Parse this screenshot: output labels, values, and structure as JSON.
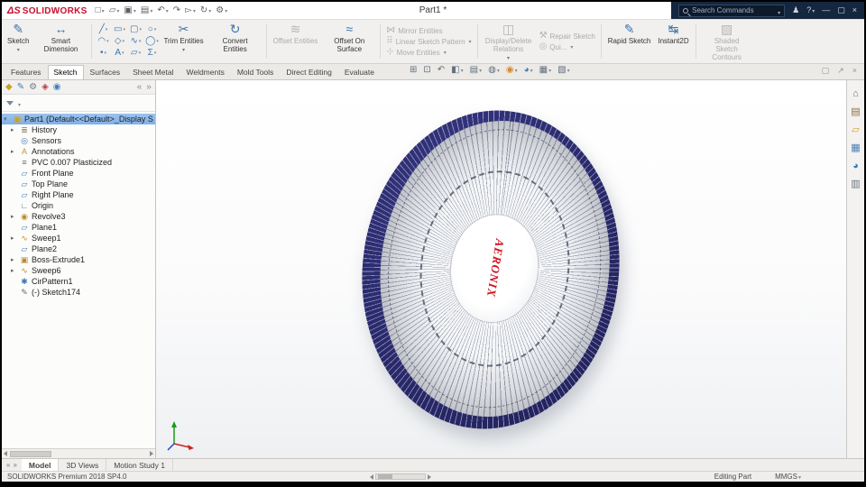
{
  "titlebar": {
    "brand_mark": "ΔS",
    "brand": "SOLIDWORKS",
    "doc_title": "Part1 *",
    "search_placeholder": "Search Commands",
    "qat_icons": [
      {
        "name": "new-file-icon",
        "glyph": "□",
        "caret": true
      },
      {
        "name": "open-file-icon",
        "glyph": "▱",
        "caret": true
      },
      {
        "name": "save-icon",
        "glyph": "▣",
        "caret": true
      },
      {
        "name": "print-icon",
        "glyph": "▤",
        "caret": true
      },
      {
        "name": "undo-icon",
        "glyph": "↶",
        "caret": true
      },
      {
        "name": "redo-icon",
        "glyph": "↷"
      },
      {
        "name": "select-icon",
        "glyph": "▻",
        "caret": true
      },
      {
        "name": "rebuild-icon",
        "glyph": "↻",
        "caret": true
      },
      {
        "name": "options-icon",
        "glyph": "⚙",
        "caret": true
      }
    ],
    "window_icons": [
      {
        "name": "user-icon",
        "glyph": "♟"
      },
      {
        "name": "help-icon",
        "glyph": "?",
        "caret": true
      },
      {
        "name": "minimize-icon",
        "glyph": "—"
      },
      {
        "name": "maximize-icon",
        "glyph": "▢"
      },
      {
        "name": "close-icon",
        "glyph": "×"
      }
    ]
  },
  "icons": {
    "sketch": "✎",
    "smart_dimension": "↔",
    "trim": "✂",
    "convert": "↻",
    "offset": "≋",
    "offset_surface": "≈",
    "mirror": "⋈",
    "linear_pattern": "⠿",
    "move": "⊹",
    "display_delete": "◫",
    "repair": "⚒",
    "quick_snaps": "◎",
    "rapid": "✎",
    "instant2d": "↹",
    "shaded_contours": "▨",
    "part_root": "▣"
  },
  "ribbon": {
    "sketch": "Sketch",
    "smart_dimension": "Smart Dimension",
    "trim": "Trim Entities",
    "convert": "Convert Entities",
    "offset": "Offset Entities",
    "offset_surface": "Offset On Surface",
    "mirror": "Mirror Entities",
    "linear_pattern": "Linear Sketch Pattern",
    "move": "Move Entities",
    "display_delete": "Display/Delete Relations",
    "repair": "Repair Sketch",
    "quick_snaps": "Qui...",
    "rapid": "Rapid Sketch",
    "instant2d": "Instant2D",
    "shaded_contours": "Shaded Sketch Contours",
    "entity_icons": [
      {
        "name": "line-icon",
        "glyph": "╱"
      },
      {
        "name": "rectangle-icon",
        "glyph": "▭"
      },
      {
        "name": "slot-icon",
        "glyph": "▢"
      },
      {
        "name": "circle-icon",
        "glyph": "○"
      },
      {
        "name": "arc-icon",
        "glyph": "◠"
      },
      {
        "name": "polygon-icon",
        "glyph": "◇"
      },
      {
        "name": "spline-icon",
        "glyph": "∿"
      },
      {
        "name": "ellipse-icon",
        "glyph": "◯"
      },
      {
        "name": "point-icon",
        "glyph": "•"
      },
      {
        "name": "text-icon",
        "glyph": "A"
      },
      {
        "name": "plane-icon",
        "glyph": "▱"
      },
      {
        "name": "equation-icon",
        "glyph": "Σ"
      }
    ]
  },
  "tabs": {
    "items": [
      "Features",
      "Sketch",
      "Surfaces",
      "Sheet Metal",
      "Weldments",
      "Mold Tools",
      "Direct Editing",
      "Evaluate"
    ],
    "active": "Sketch"
  },
  "headsup": {
    "icons": [
      {
        "name": "zoom-fit-icon",
        "glyph": "⊞",
        "color": "#5f6f7d"
      },
      {
        "name": "zoom-area-icon",
        "glyph": "⊡",
        "color": "#5f6f7d"
      },
      {
        "name": "previous-view-icon",
        "glyph": "↶",
        "color": "#5f6f7d"
      },
      {
        "name": "section-view-icon",
        "glyph": "◧",
        "color": "#5f6f7d",
        "caret": true
      },
      {
        "name": "view-orientation-icon",
        "glyph": "▤",
        "color": "#5f6f7d",
        "caret": true
      },
      {
        "name": "display-style-icon",
        "glyph": "◍",
        "color": "#5f6f7d",
        "caret": true
      },
      {
        "name": "hide-show-icon",
        "glyph": "◉",
        "color": "#d08a2e",
        "caret": true
      },
      {
        "name": "edit-appearance-icon",
        "glyph": "◕",
        "color": "#3f7fbf",
        "caret": true
      },
      {
        "name": "scene-icon",
        "glyph": "▦",
        "color": "#5f6f7d",
        "caret": true
      },
      {
        "name": "view-settings-icon",
        "glyph": "▧",
        "color": "#5f6f7d",
        "caret": true
      }
    ]
  },
  "tabrow_right": [
    {
      "name": "display-pane-icon",
      "glyph": "▢"
    },
    {
      "name": "fullscreen-icon",
      "glyph": "↗"
    },
    {
      "name": "close-pane-icon",
      "glyph": "×"
    }
  ],
  "panel": {
    "tabs": [
      {
        "name": "feature-manager-tab-icon",
        "glyph": "◆",
        "color": "#c9a227"
      },
      {
        "name": "property-manager-tab-icon",
        "glyph": "✎",
        "color": "#3f7fbf"
      },
      {
        "name": "configuration-manager-tab-icon",
        "glyph": "⚙",
        "color": "#707a84"
      },
      {
        "name": "dimxpert-manager-tab-icon",
        "glyph": "◈",
        "color": "#b04040"
      },
      {
        "name": "display-manager-tab-icon",
        "glyph": "◉",
        "color": "#3f7fbf"
      },
      {
        "name": "panel-scroll-left-icon",
        "glyph": "«",
        "color": "#8a8a8a"
      },
      {
        "name": "panel-scroll-right-icon",
        "glyph": "»",
        "color": "#8a8a8a"
      }
    ]
  },
  "tree": {
    "root": "Part1 (Default<<Default>_Display S",
    "items": [
      {
        "label": "History",
        "icon": "history-icon",
        "glyph": "≣",
        "color": "#8a7340",
        "expand": true
      },
      {
        "label": "Sensors",
        "icon": "sensors-icon",
        "glyph": "◎",
        "color": "#3a78b0",
        "expand": false
      },
      {
        "label": "Annotations",
        "icon": "annotations-icon",
        "glyph": "A",
        "color": "#c59a2a",
        "expand": true
      },
      {
        "label": "PVC 0.007 Plasticized",
        "icon": "material-icon",
        "glyph": "≡",
        "color": "#5f6b77",
        "expand": false
      },
      {
        "label": "Front Plane",
        "icon": "plane-icon",
        "glyph": "▱",
        "color": "#4a7fb5",
        "expand": false
      },
      {
        "label": "Top Plane",
        "icon": "plane-icon",
        "glyph": "▱",
        "color": "#4a7fb5",
        "expand": false
      },
      {
        "label": "Right Plane",
        "icon": "plane-icon",
        "glyph": "▱",
        "color": "#4a7fb5",
        "expand": false
      },
      {
        "label": "Origin",
        "icon": "origin-icon",
        "glyph": "∟",
        "color": "#3a78b0",
        "expand": false
      },
      {
        "label": "Revolve3",
        "icon": "revolve-icon",
        "glyph": "◉",
        "color": "#c28a2c",
        "expand": true
      },
      {
        "label": "Plane1",
        "icon": "plane-icon",
        "glyph": "▱",
        "color": "#4a7fb5",
        "expand": false
      },
      {
        "label": "Sweep1",
        "icon": "sweep-icon",
        "glyph": "∿",
        "color": "#c28a2c",
        "expand": true
      },
      {
        "label": "Plane2",
        "icon": "plane-icon",
        "glyph": "▱",
        "color": "#4a7fb5",
        "expand": false
      },
      {
        "label": "Boss-Extrude1",
        "icon": "extrude-icon",
        "glyph": "▣",
        "color": "#c28a2c",
        "expand": true
      },
      {
        "label": "Sweep6",
        "icon": "sweep-icon",
        "glyph": "∿",
        "color": "#c28a2c",
        "expand": true
      },
      {
        "label": "CirPattern1",
        "icon": "circular-pattern-icon",
        "glyph": "✱",
        "color": "#3a78b0",
        "expand": false
      },
      {
        "label": "(-) Sketch174",
        "icon": "sketch-icon",
        "glyph": "✎",
        "color": "#5f6b77",
        "expand": false
      }
    ]
  },
  "viewport": {
    "brand_text": "AERONIX"
  },
  "taskpane": {
    "icons": [
      {
        "name": "resources-home-icon",
        "glyph": "⌂",
        "color": "#67727c"
      },
      {
        "name": "design-library-icon",
        "glyph": "▤",
        "color": "#8a6d3b"
      },
      {
        "name": "file-explorer-icon",
        "glyph": "▱",
        "color": "#c9a227"
      },
      {
        "name": "view-palette-icon",
        "glyph": "▦",
        "color": "#4a7fb5"
      },
      {
        "name": "appearances-icon",
        "glyph": "◕",
        "color": "#2f7fc0"
      },
      {
        "name": "custom-properties-icon",
        "glyph": "▥",
        "color": "#67727c"
      }
    ]
  },
  "bottom": {
    "tabs": [
      "Model",
      "3D Views",
      "Motion Study 1"
    ],
    "active": "Model"
  },
  "status": {
    "left": "SOLIDWORKS Premium 2018 SP4.0",
    "editing": "Editing Part",
    "units": "MMGS"
  }
}
